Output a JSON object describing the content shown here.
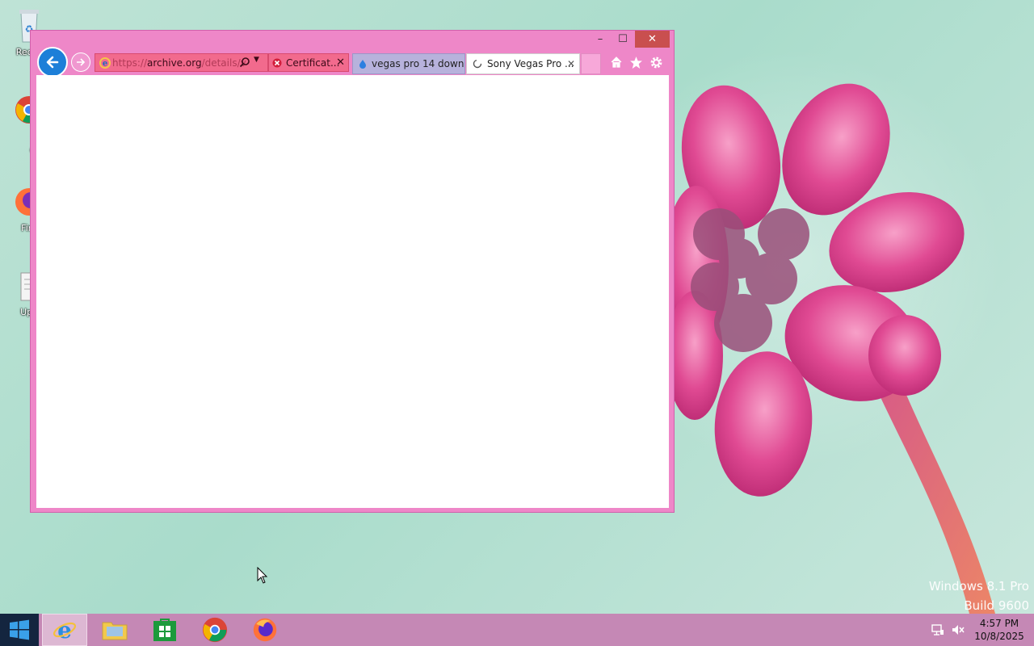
{
  "desktop": {
    "icons": [
      {
        "label": "Recyc"
      },
      {
        "label": "Goo Chro"
      },
      {
        "label": "Fire"
      },
      {
        "label": "Upo"
      }
    ],
    "watermark": {
      "line1": "Windows 8.1 Pro",
      "line2": "Build 9600"
    }
  },
  "browser": {
    "window_controls": {
      "minimize": "–",
      "maximize": "☐",
      "close": "✕"
    },
    "address": {
      "scheme": "https://",
      "host": "archive.org",
      "path": "/details/v"
    },
    "certificate_label": "Certificat...",
    "tabs": [
      {
        "label": "vegas pro 14 downl...",
        "active": false
      },
      {
        "label": "Sony Vegas Pro ...",
        "active": true,
        "loading": true
      }
    ],
    "toolbar_icons": [
      "home-icon",
      "favorites-star-icon",
      "settings-gear-icon"
    ]
  },
  "taskbar": {
    "apps": [
      "internet-explorer",
      "file-explorer",
      "windows-store",
      "google-chrome",
      "firefox"
    ],
    "active_app": "internet-explorer",
    "clock": {
      "time": "4:57 PM",
      "date": "10/8/2025"
    }
  },
  "colors": {
    "window_frame": "#ee87c8",
    "taskbar": "#c588b5",
    "start": "#14253f",
    "address_bar": "#f26a8d",
    "back_button": "#1d7fd8"
  }
}
